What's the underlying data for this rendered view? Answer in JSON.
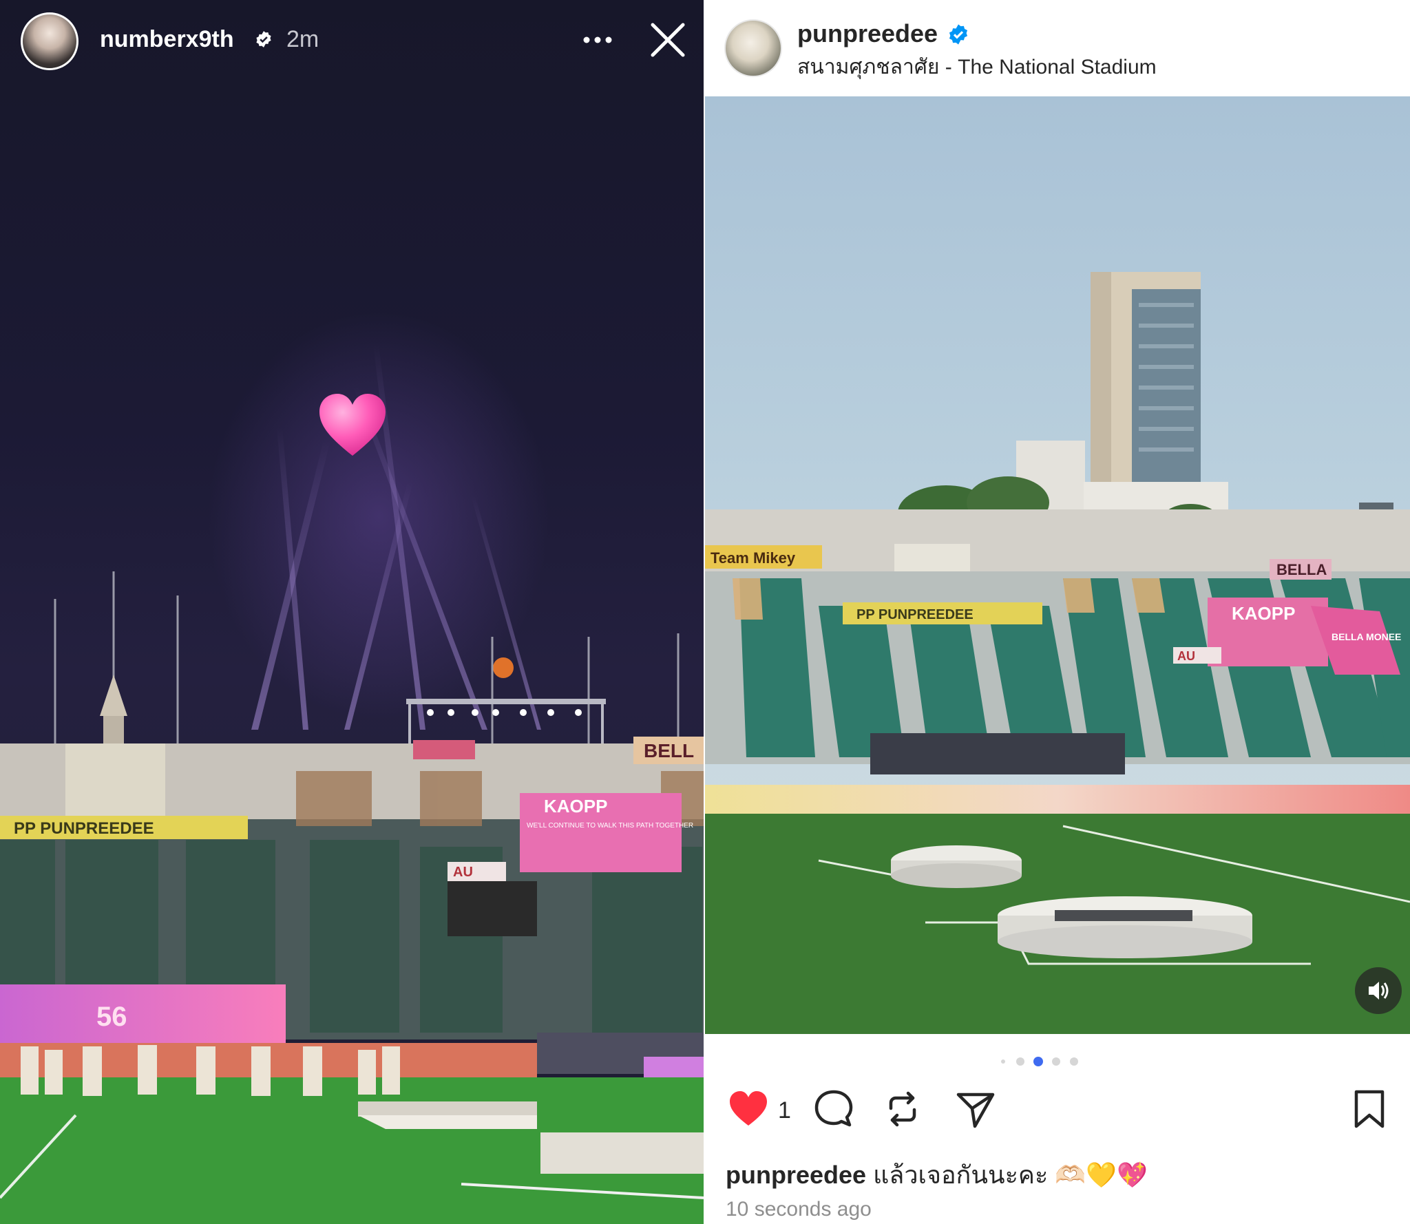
{
  "story": {
    "username": "numberx9th",
    "time": "2m",
    "verified_icon": "verified-badge-icon",
    "more_icon": "more-icon",
    "close_icon": "close-icon",
    "sticker": "pink-heart",
    "banners": {
      "fan_banner": "PP PUNPREEDEE",
      "kaopp_banner": "KAOPP",
      "kaopp_sub": "WE'LL CONTINUE TO WALK THIS PATH TOGETHER",
      "bella_banner": "BELL",
      "au_sign": "AU",
      "screen_text": "56"
    }
  },
  "post": {
    "username": "punpreedee",
    "location": "สนามศุภชลาศัย - The National Stadium",
    "verified_icon": "verified-badge-icon",
    "banners": {
      "team_banner": "Team Mikey",
      "fan_banner": "PP PUNPREEDEE",
      "kaopp_banner": "KAOPP",
      "bella_banner": "BELLA",
      "bella_monee": "BELLA MONEE",
      "au_sign": "AU"
    },
    "carousel": {
      "count": 5,
      "active_index": 2
    },
    "likes": "1",
    "caption_user": "punpreedee",
    "caption_text": "แล้วเจอกันนะคะ 🫶🏻💛💖",
    "timestamp": "10 seconds ago",
    "colors": {
      "like_red": "#ff3040",
      "carousel_active": "#3f6bf0",
      "verified_blue": "#0095f6"
    }
  }
}
